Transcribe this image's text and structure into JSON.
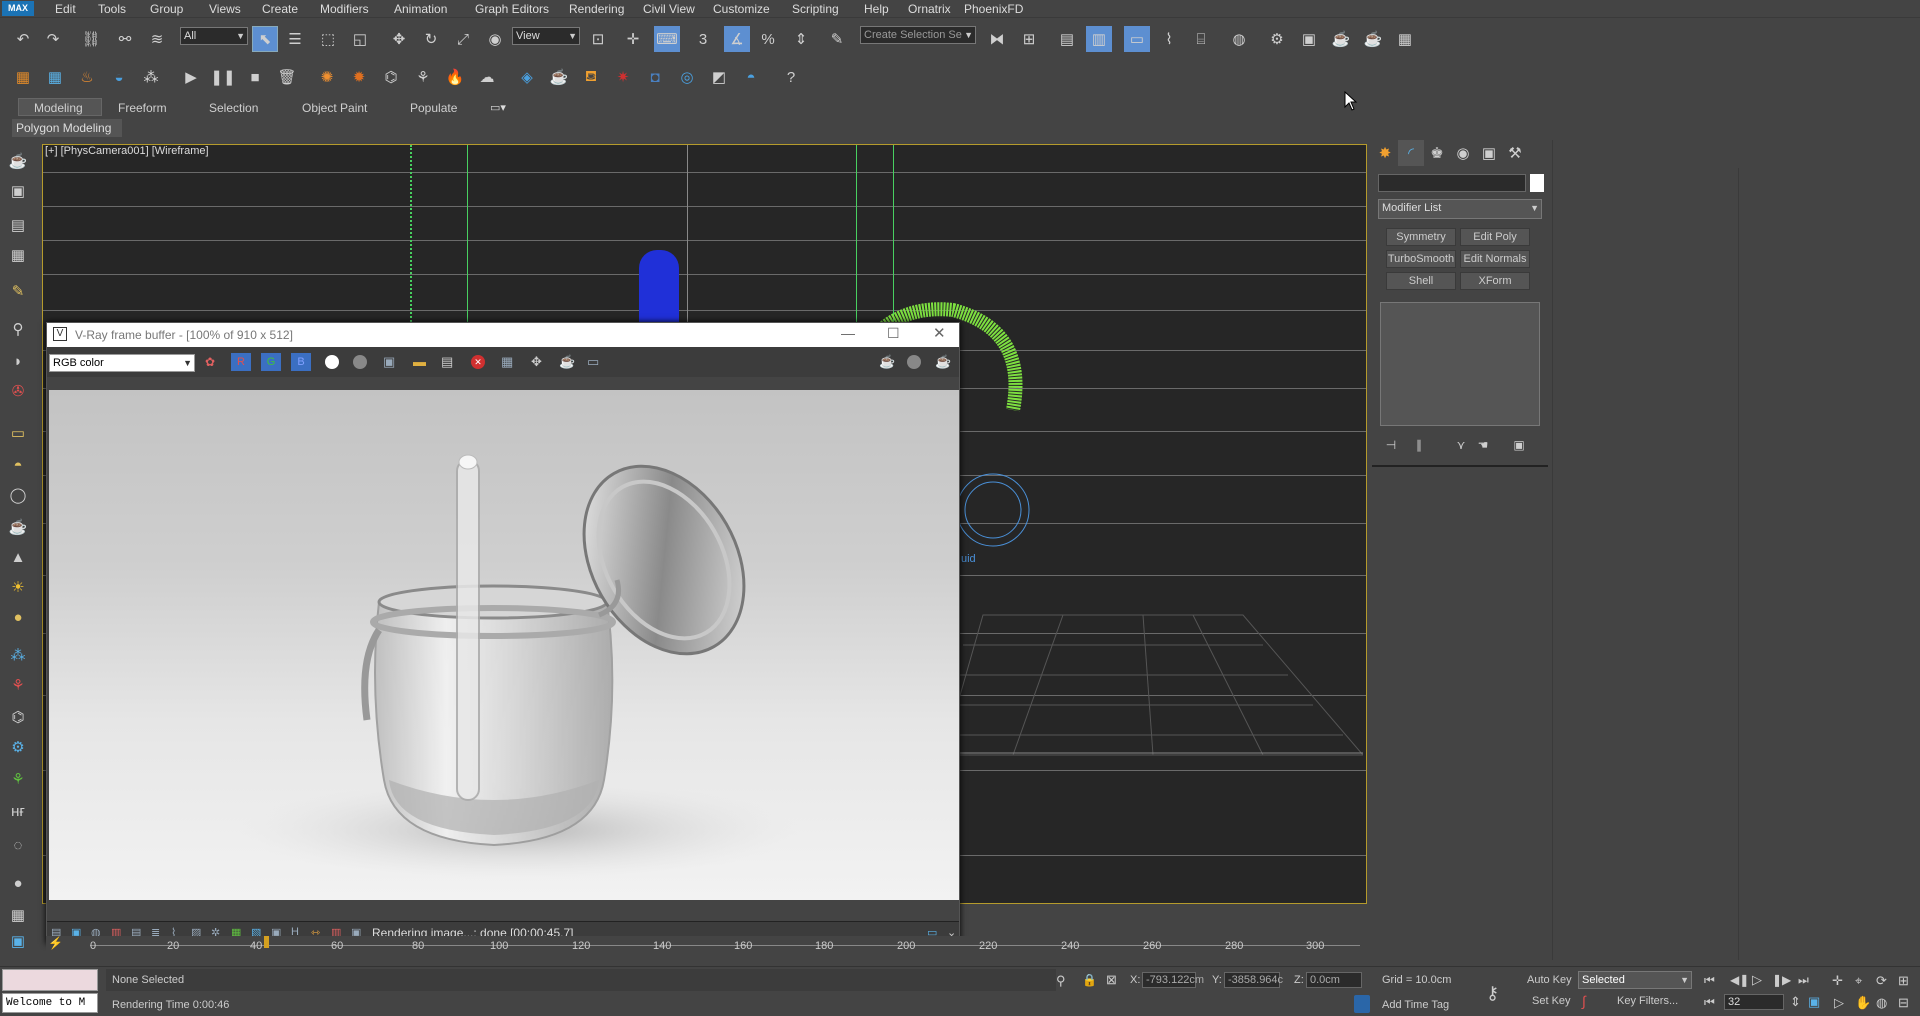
{
  "app": {
    "logo": "MAX",
    "cursor_icon": "mouse-pointer-icon"
  },
  "menu": [
    "Edit",
    "Tools",
    "Group",
    "Views",
    "Create",
    "Modifiers",
    "Animation",
    "Graph Editors",
    "Rendering",
    "Civil View",
    "Customize",
    "Scripting",
    "Help",
    "Ornatrix",
    "PhoenixFD"
  ],
  "toolbar": {
    "filter_select": "All",
    "refcoord_select": "View",
    "selection_set_placeholder": "Create Selection Se",
    "snap_label": "3"
  },
  "ribbon": {
    "tabs": [
      "Modeling",
      "Freeform",
      "Selection",
      "Object Paint",
      "Populate"
    ],
    "active_tab": "Modeling",
    "panel": "Polygon Modeling"
  },
  "viewport": {
    "label": "[+] [PhysCamera001] [Wireframe]",
    "fluid_label": "uid",
    "accent": "#b59b2c"
  },
  "command_panel": {
    "modifier_list": "Modifier List",
    "buttons": [
      "Symmetry",
      "Edit Poly",
      "TurboSmooth",
      "Edit Normals",
      "Shell",
      "XForm"
    ]
  },
  "vfb": {
    "title": "V-Ray frame buffer - [100% of 910 x 512]",
    "channel_select": "RGB color",
    "channels": [
      "R",
      "G",
      "B"
    ],
    "status": "Rendering image...: done [00:00:45.7]"
  },
  "timeline": {
    "ticks": [
      "0",
      "20",
      "40",
      "60",
      "80",
      "100",
      "120",
      "140",
      "160",
      "180",
      "200",
      "220",
      "240",
      "260",
      "280",
      "300"
    ],
    "current_frame": "32"
  },
  "status": {
    "listener": "Welcome to M",
    "selection": "None Selected",
    "render_time": "Rendering Time  0:00:46",
    "x_label": "X:",
    "x_value": "-793.122cm",
    "y_label": "Y:",
    "y_value": "-3858.964c",
    "z_label": "Z:",
    "z_value": "0.0cm",
    "grid": "Grid = 10.0cm",
    "add_time_tag": "Add Time Tag",
    "auto_key": "Auto Key",
    "set_key": "Set Key",
    "key_mode_select": "Selected",
    "key_filters": "Key Filters...",
    "frame": "32"
  }
}
